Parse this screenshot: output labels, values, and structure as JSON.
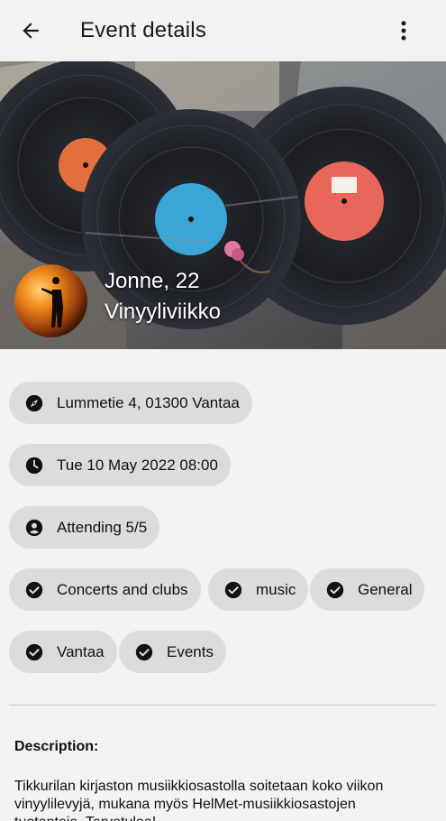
{
  "appbar": {
    "title": "Event details",
    "back_icon": "arrow-left-icon",
    "more_icon": "more-vertical-icon"
  },
  "hero": {
    "host": "Jonne, 22",
    "event_title": "Vinyyliviikko"
  },
  "details": {
    "address": "Lummetie 4, 01300 Vantaa",
    "datetime": "Tue 10 May 2022 08:00",
    "attending": "Attending 5/5"
  },
  "tags": [
    "Concerts and clubs",
    "music",
    "General",
    "Vantaa",
    "Events"
  ],
  "description": {
    "label": "Description:",
    "text": "Tikkurilan kirjaston musiikkiosastolla soitetaan koko viikon vinyylilevyjä, mukana myös HelMet-musiikkiosastojen tuotantoja. Tervetuloa!"
  },
  "colors": {
    "background": "#f2f2f2",
    "chip": "#dcdcdc",
    "text": "#111111"
  }
}
